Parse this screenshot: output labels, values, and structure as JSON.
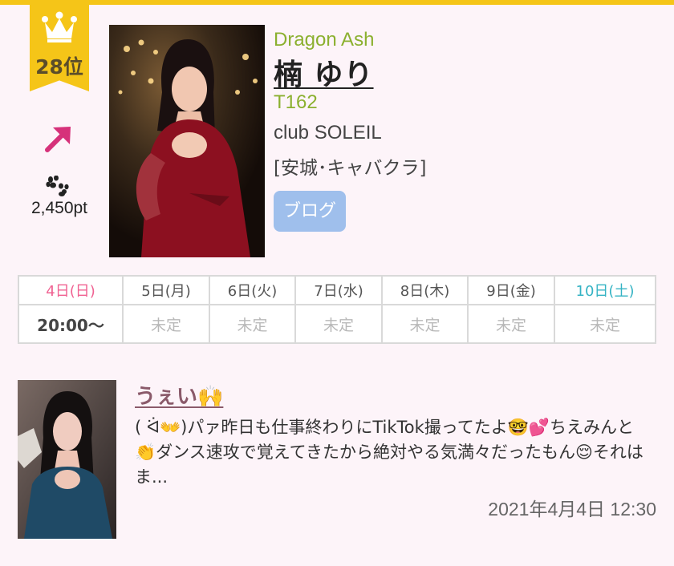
{
  "colors": {
    "accent_yellow": "#f5c518",
    "group_green": "#8bb02f",
    "blog_button_blue": "#9fbfec",
    "sunday_pink": "#f06292",
    "saturday_teal": "#35b3c4",
    "trend_arrow_magenta": "#d6317a"
  },
  "ranking": {
    "rank": "28位",
    "trend_icon": "arrow-up-right-icon",
    "points_icon": "paw-print-icon",
    "points": "2,450pt"
  },
  "profile": {
    "group": "Dragon Ash",
    "name": "楠 ゆり",
    "height": "T162",
    "shop": "club SOLEIL",
    "category": "[安城･キャバクラ]",
    "blog_button": "ブログ"
  },
  "schedule": {
    "days": [
      "4日(日)",
      "5日(月)",
      "6日(火)",
      "7日(水)",
      "8日(木)",
      "9日(金)",
      "10日(土)"
    ],
    "times": [
      "20:00〜",
      "未定",
      "未定",
      "未定",
      "未定",
      "未定",
      "未定"
    ]
  },
  "blog": {
    "title": "うぇい🙌",
    "excerpt": "( ᐛ👐)パァ昨日も仕事終わりにTikTok撮ってたよ🤓💕ちえみんと👏ダンス速攻で覚えてきたから絶対やる気満々だったもん😌それはま...",
    "date": "2021年4月4日 12:30"
  }
}
